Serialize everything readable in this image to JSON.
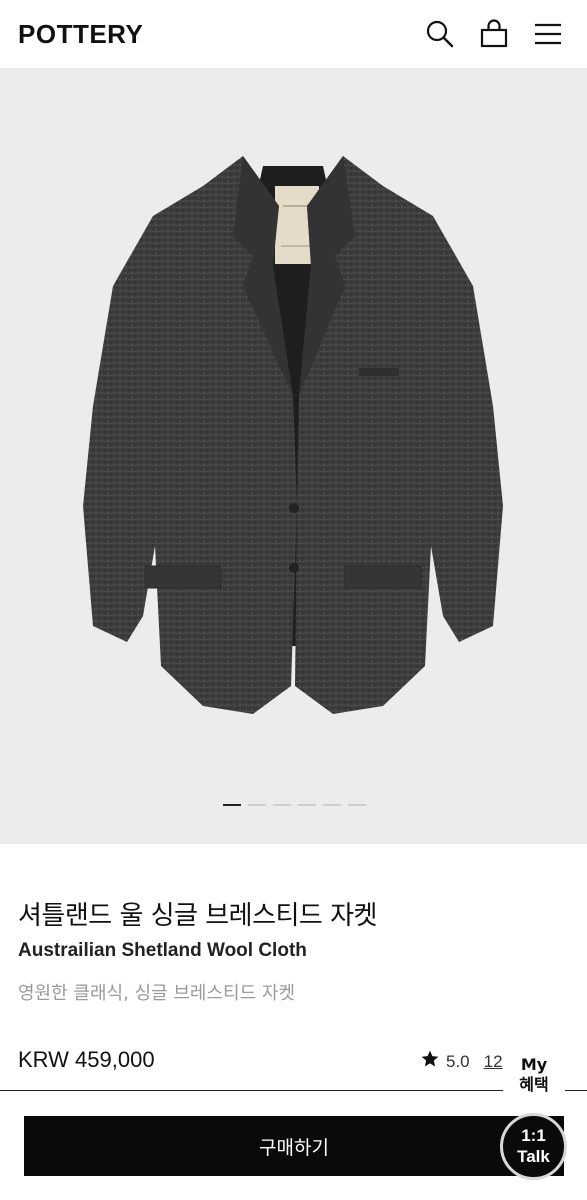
{
  "header": {
    "logo": "POTTERY",
    "icons": [
      "search-icon",
      "cart-icon",
      "menu-icon"
    ]
  },
  "hero": {
    "image": "charcoal-wool-jacket",
    "slide_count": 6,
    "active_slide": 1
  },
  "product": {
    "title_ko": "셔틀랜드 울 싱글 브레스티드 자켓",
    "title_en": "Austrailian Shetland Wool Cloth",
    "subtitle": "영원한 클래식, 싱글 브레스티드 자켓",
    "price": "KRW 459,000",
    "rating": "5.0",
    "review_count": "12"
  },
  "floating": {
    "my_line1": "My",
    "my_line2": "혜택",
    "talk_line1": "1:1",
    "talk_line2": "Talk"
  },
  "actions": {
    "buy_label": "구매하기"
  },
  "colors": {
    "accent": "#0a0a0a",
    "hero_bg": "#ececec",
    "muted_text": "#9a9a9a"
  }
}
